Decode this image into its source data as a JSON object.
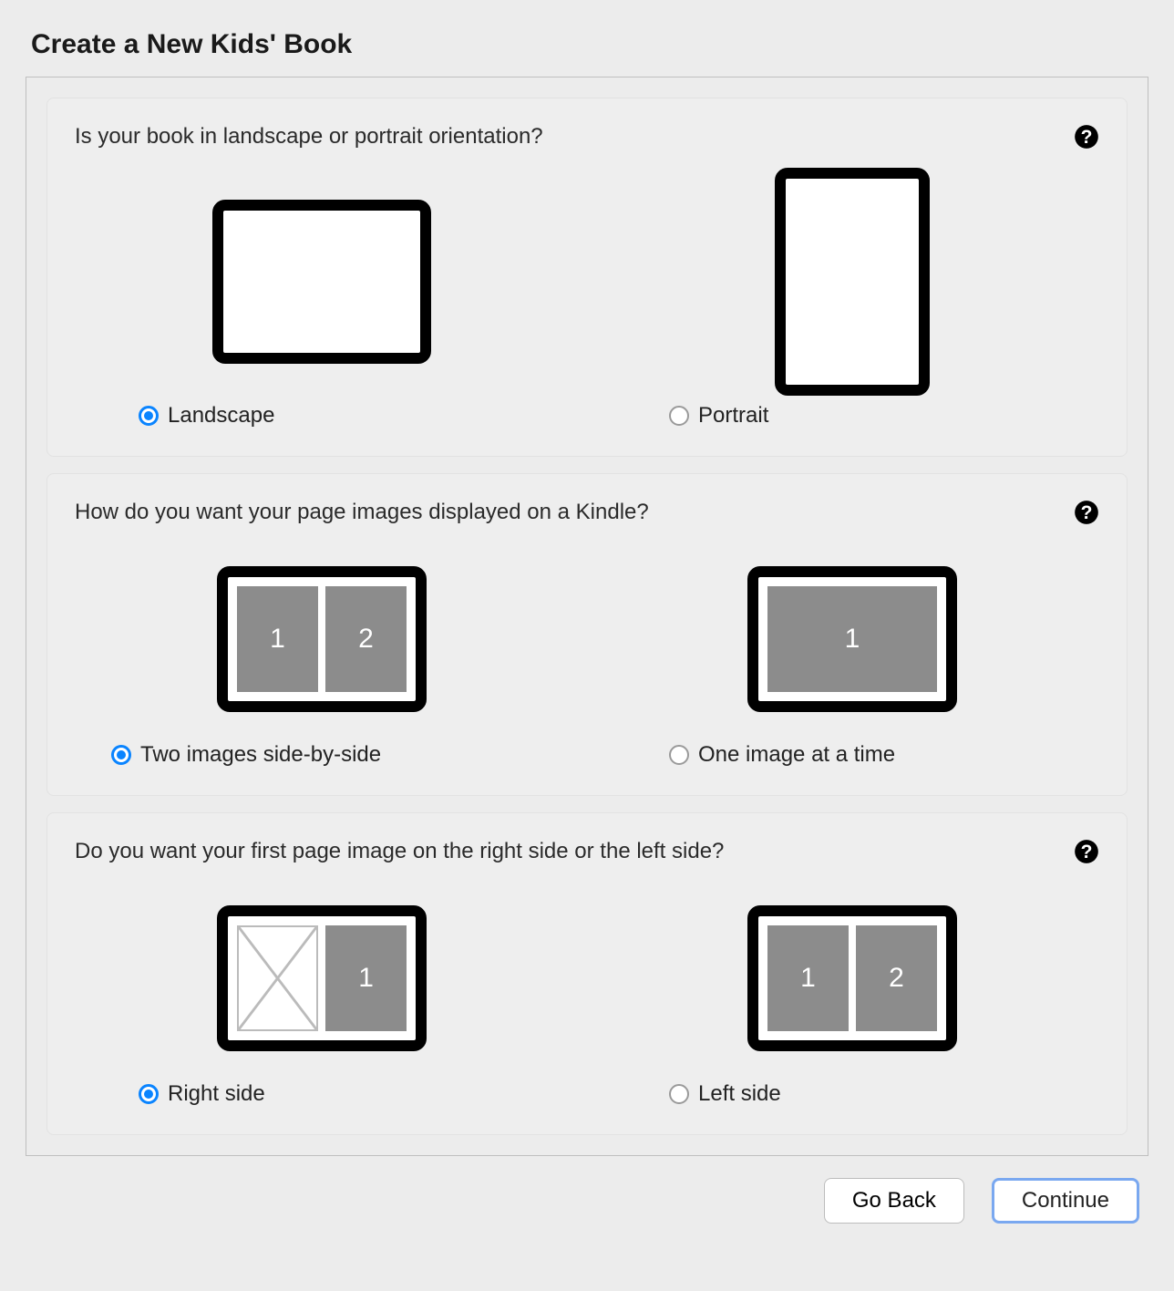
{
  "title": "Create a New Kids' Book",
  "sections": {
    "orientation": {
      "question": "Is your book in landscape or portrait orientation?",
      "options": {
        "landscape": {
          "label": "Landscape",
          "selected": true
        },
        "portrait": {
          "label": "Portrait",
          "selected": false
        }
      }
    },
    "display": {
      "question": "How do you want your page images displayed on a Kindle?",
      "options": {
        "two": {
          "label": "Two images side-by-side",
          "digits": [
            "1",
            "2"
          ],
          "selected": true
        },
        "one": {
          "label": "One image at a time",
          "digits": [
            "1"
          ],
          "selected": false
        }
      }
    },
    "firstpage": {
      "question": "Do you want your first page image on the right side or the left side?",
      "options": {
        "right": {
          "label": "Right side",
          "digits": [
            "1"
          ],
          "selected": true
        },
        "left": {
          "label": "Left side",
          "digits": [
            "1",
            "2"
          ],
          "selected": false
        }
      }
    }
  },
  "buttons": {
    "back": "Go Back",
    "continue": "Continue"
  }
}
